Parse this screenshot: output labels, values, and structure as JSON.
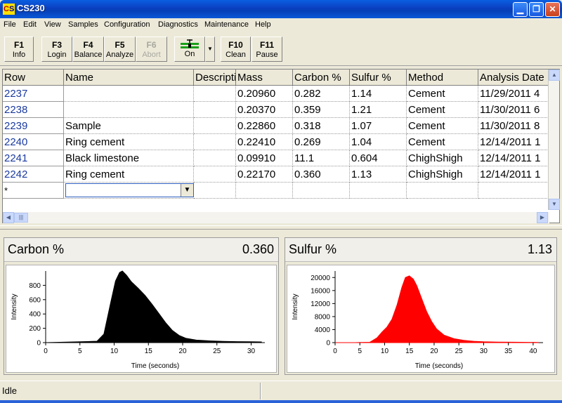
{
  "window": {
    "title": "CS230",
    "icon_text": "CS"
  },
  "menu": [
    {
      "label": "File"
    },
    {
      "label": "Edit"
    },
    {
      "label": "View"
    },
    {
      "label": "Samples"
    },
    {
      "label": "Configuration"
    },
    {
      "label": "Diagnostics"
    },
    {
      "label": "Maintenance"
    },
    {
      "label": "Help"
    }
  ],
  "toolbar": {
    "buttons": [
      {
        "key": "F1",
        "label": "Info"
      },
      {
        "key": "F3",
        "label": "Login"
      },
      {
        "key": "F4",
        "label": "Balance"
      },
      {
        "key": "F5",
        "label": "Analyze"
      },
      {
        "key": "F6",
        "label": "Abort"
      },
      {
        "key": "F10",
        "label": "Clean"
      },
      {
        "key": "F11",
        "label": "Pause"
      }
    ],
    "on_label": "On"
  },
  "grid": {
    "columns": [
      "Row",
      "Name",
      "Description",
      "Mass",
      "Carbon %",
      "Sulfur %",
      "Method",
      "Analysis Date"
    ],
    "rows": [
      [
        "2237",
        "",
        "",
        "0.20960",
        "0.282",
        "1.14",
        "Cement",
        "11/29/2011 4"
      ],
      [
        "2238",
        "",
        "",
        "0.20370",
        "0.359",
        "1.21",
        "Cement",
        "11/30/2011 6"
      ],
      [
        "2239",
        "Sample",
        "",
        "0.22860",
        "0.318",
        "1.07",
        "Cement",
        "11/30/2011 8"
      ],
      [
        "2240",
        "Ring cement",
        "",
        "0.22410",
        "0.269",
        "1.04",
        "Cement",
        "12/14/2011 1"
      ],
      [
        "2241",
        "Black limestone",
        "",
        "0.09910",
        "11.1",
        "0.604",
        "ChighShigh",
        "12/14/2011 1"
      ],
      [
        "2242",
        "Ring cement",
        "",
        "0.22170",
        "0.360",
        "1.13",
        "ChighShigh",
        "12/14/2011 1"
      ]
    ],
    "new_row_marker": "*"
  },
  "carbon": {
    "name": "Carbon %",
    "value": "0.360",
    "color": "#000000",
    "chart_data": {
      "type": "area",
      "xlabel": "Time (seconds)",
      "ylabel": "Intensity",
      "xlim": [
        0,
        32
      ],
      "ylim": [
        0,
        1000
      ],
      "xticks": [
        0,
        5,
        10,
        15,
        20,
        25,
        30
      ],
      "yticks": [
        0,
        200,
        400,
        600,
        800
      ],
      "x": [
        0,
        2,
        4,
        6,
        7.5,
        8.5,
        9.5,
        10.2,
        10.8,
        11.2,
        11.8,
        12.5,
        13.5,
        14.5,
        15.5,
        16.5,
        17.5,
        18.5,
        19.5,
        20.5,
        22,
        24,
        26,
        28,
        30,
        31.5
      ],
      "y": [
        0,
        5,
        10,
        15,
        20,
        120,
        560,
        860,
        980,
        1000,
        940,
        850,
        760,
        660,
        540,
        410,
        280,
        170,
        100,
        60,
        35,
        25,
        18,
        14,
        12,
        10
      ]
    }
  },
  "sulfur": {
    "name": "Sulfur %",
    "value": "1.13",
    "color": "#ff0000",
    "chart_data": {
      "type": "area",
      "xlabel": "Time (seconds)",
      "ylabel": "Intensity",
      "xlim": [
        0,
        42
      ],
      "ylim": [
        0,
        22000
      ],
      "xticks": [
        0,
        5,
        10,
        15,
        20,
        25,
        30,
        35,
        40
      ],
      "yticks": [
        0,
        4000,
        8000,
        12000,
        16000,
        20000
      ],
      "x": [
        0,
        4,
        7,
        8.5,
        9.5,
        10.5,
        11.5,
        12.5,
        13.5,
        14.2,
        15,
        15.8,
        16.5,
        17.5,
        18.5,
        19.5,
        20.5,
        22,
        24,
        26,
        28,
        30,
        33,
        36,
        39,
        41
      ],
      "y": [
        0,
        0,
        100,
        1500,
        3300,
        4800,
        7200,
        11500,
        17000,
        20000,
        20500,
        19500,
        17500,
        13500,
        9500,
        6500,
        4200,
        2300,
        1200,
        700,
        400,
        250,
        180,
        120,
        80,
        60
      ]
    }
  },
  "status": {
    "text": "Idle"
  }
}
